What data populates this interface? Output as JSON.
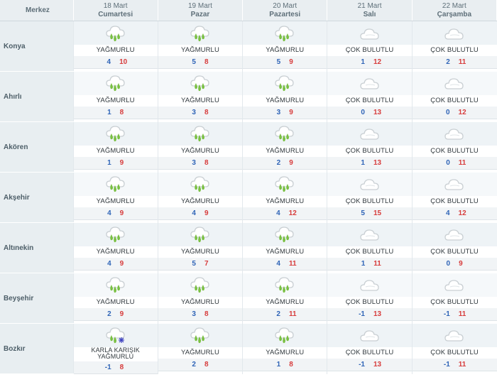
{
  "header": {
    "merkez_label": "Merkez",
    "days": [
      {
        "date": "18 Mart",
        "weekday": "Cumartesi"
      },
      {
        "date": "19 Mart",
        "weekday": "Pazar"
      },
      {
        "date": "20 Mart",
        "weekday": "Pazartesi"
      },
      {
        "date": "21 Mart",
        "weekday": "Salı"
      },
      {
        "date": "22 Mart",
        "weekday": "Çarşamba"
      }
    ]
  },
  "colors": {
    "min_temp": "#2f64b7",
    "max_temp": "#d73c3c",
    "rain_drop": "#7ac043",
    "cloud": "#c9cfd3",
    "snowflake": "#3b3fbf"
  },
  "rows": [
    {
      "city": "Konya",
      "days": [
        {
          "icon": "rain-icon",
          "condition": "YAĞMURLU",
          "min": "4",
          "max": "10"
        },
        {
          "icon": "rain-icon",
          "condition": "YAĞMURLU",
          "min": "5",
          "max": "8"
        },
        {
          "icon": "rain-icon",
          "condition": "YAĞMURLU",
          "min": "5",
          "max": "9"
        },
        {
          "icon": "cloud-icon",
          "condition": "ÇOK BULUTLU",
          "min": "1",
          "max": "12"
        },
        {
          "icon": "cloud-icon",
          "condition": "ÇOK BULUTLU",
          "min": "2",
          "max": "11"
        }
      ]
    },
    {
      "city": "Ahırlı",
      "days": [
        {
          "icon": "rain-icon",
          "condition": "YAĞMURLU",
          "min": "1",
          "max": "8"
        },
        {
          "icon": "rain-icon",
          "condition": "YAĞMURLU",
          "min": "3",
          "max": "8"
        },
        {
          "icon": "rain-icon",
          "condition": "YAĞMURLU",
          "min": "3",
          "max": "9"
        },
        {
          "icon": "cloud-icon",
          "condition": "ÇOK BULUTLU",
          "min": "0",
          "max": "13"
        },
        {
          "icon": "cloud-icon",
          "condition": "ÇOK BULUTLU",
          "min": "0",
          "max": "12"
        }
      ]
    },
    {
      "city": "Akören",
      "days": [
        {
          "icon": "rain-icon",
          "condition": "YAĞMURLU",
          "min": "1",
          "max": "9"
        },
        {
          "icon": "rain-icon",
          "condition": "YAĞMURLU",
          "min": "3",
          "max": "8"
        },
        {
          "icon": "rain-icon",
          "condition": "YAĞMURLU",
          "min": "2",
          "max": "9"
        },
        {
          "icon": "cloud-icon",
          "condition": "ÇOK BULUTLU",
          "min": "1",
          "max": "13"
        },
        {
          "icon": "cloud-icon",
          "condition": "ÇOK BULUTLU",
          "min": "0",
          "max": "11"
        }
      ]
    },
    {
      "city": "Akşehir",
      "days": [
        {
          "icon": "rain-icon",
          "condition": "YAĞMURLU",
          "min": "4",
          "max": "9"
        },
        {
          "icon": "rain-icon",
          "condition": "YAĞMURLU",
          "min": "4",
          "max": "9"
        },
        {
          "icon": "rain-icon",
          "condition": "YAĞMURLU",
          "min": "4",
          "max": "12"
        },
        {
          "icon": "cloud-icon",
          "condition": "ÇOK BULUTLU",
          "min": "5",
          "max": "15"
        },
        {
          "icon": "cloud-icon",
          "condition": "ÇOK BULUTLU",
          "min": "4",
          "max": "12"
        }
      ]
    },
    {
      "city": "Altınekin",
      "days": [
        {
          "icon": "rain-icon",
          "condition": "YAĞMURLU",
          "min": "4",
          "max": "9"
        },
        {
          "icon": "rain-icon",
          "condition": "YAĞMURLU",
          "min": "5",
          "max": "7"
        },
        {
          "icon": "rain-icon",
          "condition": "YAĞMURLU",
          "min": "4",
          "max": "11"
        },
        {
          "icon": "cloud-icon",
          "condition": "ÇOK BULUTLU",
          "min": "1",
          "max": "11"
        },
        {
          "icon": "cloud-icon",
          "condition": "ÇOK BULUTLU",
          "min": "0",
          "max": "9"
        }
      ]
    },
    {
      "city": "Beyşehir",
      "days": [
        {
          "icon": "rain-icon",
          "condition": "YAĞMURLU",
          "min": "2",
          "max": "9"
        },
        {
          "icon": "rain-icon",
          "condition": "YAĞMURLU",
          "min": "3",
          "max": "8"
        },
        {
          "icon": "rain-icon",
          "condition": "YAĞMURLU",
          "min": "2",
          "max": "11"
        },
        {
          "icon": "cloud-icon",
          "condition": "ÇOK BULUTLU",
          "min": "-1",
          "max": "13"
        },
        {
          "icon": "cloud-icon",
          "condition": "ÇOK BULUTLU",
          "min": "-1",
          "max": "11"
        }
      ]
    },
    {
      "city": "Bozkır",
      "days": [
        {
          "icon": "sleet-icon",
          "condition": "KARLA KARIŞIK YAĞMURLU",
          "min": "-1",
          "max": "8"
        },
        {
          "icon": "rain-icon",
          "condition": "YAĞMURLU",
          "min": "2",
          "max": "8"
        },
        {
          "icon": "rain-icon",
          "condition": "YAĞMURLU",
          "min": "1",
          "max": "8"
        },
        {
          "icon": "cloud-icon",
          "condition": "ÇOK BULUTLU",
          "min": "-1",
          "max": "13"
        },
        {
          "icon": "cloud-icon",
          "condition": "ÇOK BULUTLU",
          "min": "-1",
          "max": "11"
        }
      ]
    }
  ]
}
